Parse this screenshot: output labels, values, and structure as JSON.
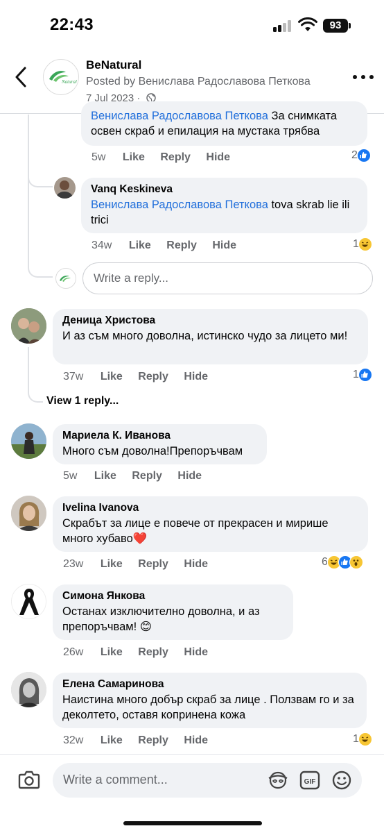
{
  "status_bar": {
    "time": "22:43",
    "battery": "93"
  },
  "header": {
    "page_name": "BeNatural",
    "posted_by": "Posted by Венислава Радославова Петкова",
    "date": "7 Jul 2023 ·",
    "logo_text": "Natural"
  },
  "comments": [
    {
      "mention": "Венислава Радославова Петкова",
      "text_line1": " За снимката",
      "text_line2": "освен скраб и епилация на мустака трябва",
      "time": "5w",
      "like": "Like",
      "reply": "Reply",
      "hide": "Hide",
      "reaction_count": "2",
      "reactions": [
        "like"
      ]
    },
    {
      "author": "Vanq Keskineva",
      "mention": "Венислава Радославова Петкова",
      "text_rest": " tova skrab lie ili trici",
      "time": "34w",
      "like": "Like",
      "reply": "Reply",
      "hide": "Hide",
      "reaction_count": "1",
      "reactions": [
        "haha"
      ]
    },
    {
      "author": "Деница Христова",
      "text": "И аз съм много доволна, истинско чудо за лицето ми!",
      "time": "37w",
      "like": "Like",
      "reply": "Reply",
      "hide": "Hide",
      "reaction_count": "1",
      "reactions": [
        "like"
      ]
    },
    {
      "author": "Мариела К. Иванова",
      "text": "Много съм доволна!Препоръчвам",
      "time": "5w",
      "like": "Like",
      "reply": "Reply",
      "hide": "Hide"
    },
    {
      "author": "Ivelina Ivanova",
      "text": "Скрабът за лице е повече от прекрасен и мирише много хубаво",
      "emoji": "❤️",
      "time": "23w",
      "like": "Like",
      "reply": "Reply",
      "hide": "Hide",
      "reaction_count": "6",
      "reactions": [
        "haha",
        "like",
        "wow"
      ]
    },
    {
      "author": "Симона Янкова",
      "text": "Останах изключително доволна, и аз препоръчвам!",
      "emoji": "😊",
      "time": "26w",
      "like": "Like",
      "reply": "Reply",
      "hide": "Hide"
    },
    {
      "author": "Елена Самаринова",
      "text": "Наистина много добър скраб за лице . Ползвам го и за деколтето, оставя копринена кожа",
      "time": "32w",
      "like": "Like",
      "reply": "Reply",
      "hide": "Hide",
      "reaction_count": "1",
      "reactions": [
        "haha"
      ]
    }
  ],
  "reply_input": {
    "placeholder": "Write a reply..."
  },
  "view_replies": "View 1 reply...",
  "comment_input": {
    "placeholder": "Write a comment..."
  },
  "icons": [
    "back-icon",
    "more-icon",
    "globe-icon",
    "camera-icon",
    "avatar-sticker-icon",
    "gif-icon",
    "emoji-icon"
  ],
  "colors": {
    "accent": "#1877f2",
    "mention": "#216fdb",
    "bubble": "#f0f2f5",
    "muted": "#65676b"
  }
}
